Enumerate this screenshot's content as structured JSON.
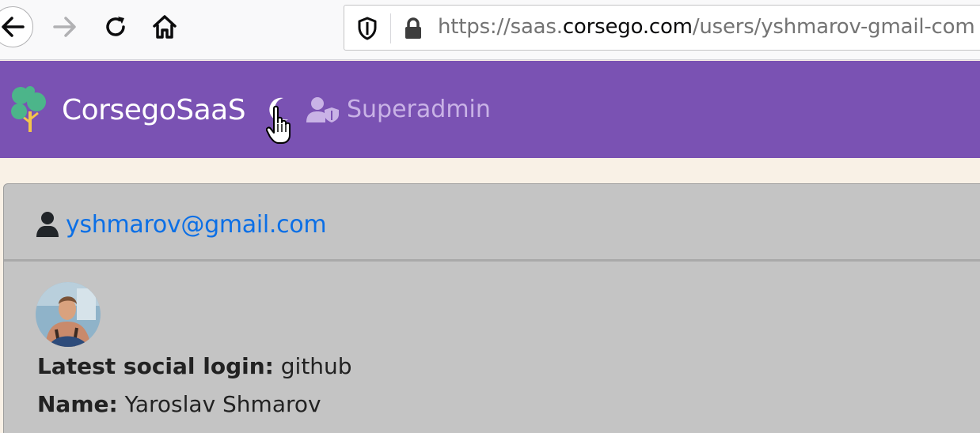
{
  "browser": {
    "url_scheme": "https://saas.",
    "url_host": "corsego.com",
    "url_path": "/users/yshmarov-gmail-com",
    "icons": [
      "back-icon",
      "forward-icon",
      "reload-icon",
      "home-icon",
      "shield-icon",
      "lock-icon"
    ]
  },
  "navbar": {
    "brand": "CorsegoSaaS",
    "superadmin_label": "Superadmin",
    "background": "#7a52b3",
    "icons": [
      "tree-logo-icon",
      "moon-icon",
      "user-shield-icon"
    ]
  },
  "card": {
    "email": "yshmarov@gmail.com",
    "fields": {
      "login_label": "Latest social login:",
      "login_value": " github",
      "name_label": "Name:",
      "name_value": " Yaroslav Shmarov"
    },
    "link_color": "#0b6fe6"
  }
}
